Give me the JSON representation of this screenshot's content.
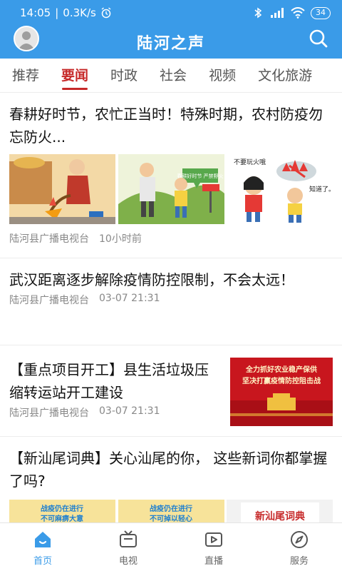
{
  "status": {
    "time": "14:05",
    "speed": "0.3K/s",
    "battery": "34"
  },
  "app": {
    "title": "陆河之声"
  },
  "tabs": [
    {
      "label": "推荐"
    },
    {
      "label": "要闻"
    },
    {
      "label": "时政"
    },
    {
      "label": "社会"
    },
    {
      "label": "视频"
    },
    {
      "label": "文化旅游"
    }
  ],
  "articles": [
    {
      "title": "春耕好时节，农忙正当时！特殊时期，农村防疫勿忘防火...",
      "source": "陆河县广播电视台",
      "time": "10小时前",
      "image_text": {
        "sign": "春耕好时节 严禁野火",
        "caption1": "不要玩火哦",
        "caption2": "知道了。"
      }
    },
    {
      "title": "武汉距离逐步解除疫情防控限制，不会太远！",
      "source": "陆河县广播电视台",
      "time": "03-07 21:31"
    },
    {
      "title": "【重点项目开工】县生活垃圾压缩转运站开工建设",
      "source": "陆河县广播电视台",
      "time": "03-07 21:31",
      "image_text": {
        "line1": "全力抓好农业稳产保供",
        "line2": "坚决打赢疫情防控阻击战"
      }
    },
    {
      "title": "【新汕尾词典】关心汕尾的你， 这些新词你都掌握了吗?",
      "image_text": {
        "a": "战疫仍在进行",
        "b": "不可麻痹大意",
        "c": "战疫仍在进行",
        "d": "不可掉以轻心",
        "e": "新汕尾词典"
      }
    }
  ],
  "bottom_nav": [
    {
      "label": "首页",
      "icon": "home-icon"
    },
    {
      "label": "电视",
      "icon": "tv-icon"
    },
    {
      "label": "直播",
      "icon": "live-icon"
    },
    {
      "label": "服务",
      "icon": "compass-icon"
    }
  ],
  "colors": {
    "primary": "#3a9be8",
    "active_tab": "#c62828"
  }
}
